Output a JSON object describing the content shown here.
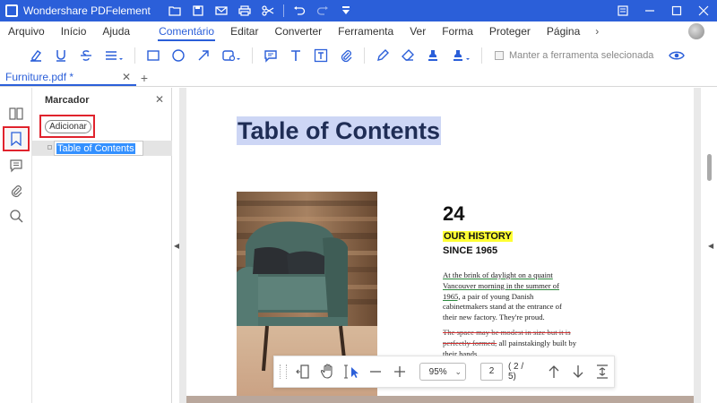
{
  "app": {
    "title": "Wondershare PDFelement"
  },
  "menu": {
    "items": [
      "Arquivo",
      "Início",
      "Ajuda",
      "Comentário",
      "Editar",
      "Converter",
      "Ferramenta",
      "Ver",
      "Forma",
      "Proteger",
      "Página"
    ],
    "active": "Comentário"
  },
  "toolbar": {
    "keep_tool_label": "Manter a ferramenta selecionada"
  },
  "tab": {
    "name": "Furniture.pdf *"
  },
  "bookmark_panel": {
    "title": "Marcador",
    "add_button": "Adicionar",
    "entries": [
      "Table of Contents"
    ]
  },
  "document": {
    "heading": "Table of Contents",
    "number": "24",
    "history_title": "OUR HISTORY",
    "since": "SINCE 1965",
    "para1_underlined": "At the brink of daylight on a quaint Vancouver morning in the summer of 1965,",
    "para1_rest": " a pair of young Danish cabinetmakers stand at the entrance of their new factory. They're proud.",
    "para2_struck": "The space may be modest in size but it is perfectly formed,",
    "para2_rest": " all painstakingly built by their hands."
  },
  "nav": {
    "zoom": "95%",
    "page": "2",
    "page_count": "( 2 / 5)"
  },
  "colors": {
    "brand_blue": "#2b5fd9",
    "highlight_red": "#e0232d",
    "heading_highlight": "#cdd6f5",
    "yellow_highlight": "#ffff33"
  }
}
